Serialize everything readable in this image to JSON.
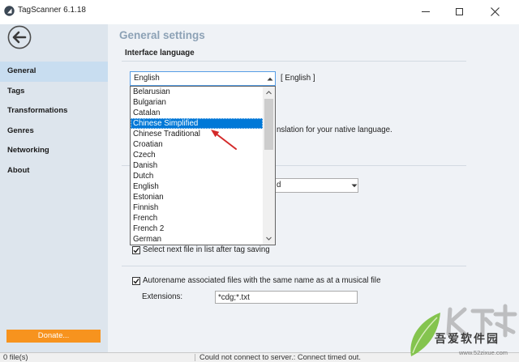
{
  "window": {
    "title": "TagScanner 6.1.18"
  },
  "icons": {
    "app": "app-icon",
    "back": "back-arrow-icon",
    "minimize": "minimize-icon",
    "maximize": "maximize-icon",
    "close": "close-icon",
    "dropdown": "dropdown-arrow-icon",
    "scroll_up": "scroll-up-icon",
    "scroll_down": "scroll-down-icon",
    "check": "checkmark-icon"
  },
  "colors": {
    "accent": "#0078d7",
    "sidebar_bg": "#dde5ed",
    "content_bg": "#eff2f6",
    "nav_selected_bg": "#c8ddf0",
    "donate_bg": "#f7931e",
    "heading": "#8da2b6",
    "annotation_arrow": "#d42a2a"
  },
  "sidebar": {
    "items": [
      {
        "label": "General",
        "selected": true
      },
      {
        "label": "Tags",
        "selected": false
      },
      {
        "label": "Transformations",
        "selected": false
      },
      {
        "label": "Genres",
        "selected": false
      },
      {
        "label": "Networking",
        "selected": false
      },
      {
        "label": "About",
        "selected": false
      }
    ],
    "donate_label": "Donate..."
  },
  "main": {
    "heading": "General settings",
    "language": {
      "section_label": "Interface language",
      "selected_value": "English",
      "current_language": "[ English ]",
      "dropdown_open": true,
      "options": [
        "Belarusian",
        "Bulgarian",
        "Catalan",
        "Chinese Simplified",
        "Chinese Traditional",
        "Croatian",
        "Czech",
        "Danish",
        "Dutch",
        "English",
        "Estonian",
        "Finnish",
        "French",
        "French 2",
        "German"
      ],
      "highlighted_index": 3,
      "hint_text_visible": "nslation for your native language."
    },
    "second_combo": {
      "visible_text": "d"
    },
    "select_next_file": {
      "label": "Select next file in list after tag saving",
      "checked": true
    },
    "autorename": {
      "label": "Autorename associated files with the same name as at a musical file",
      "checked": true
    },
    "extensions": {
      "label": "Extensions:",
      "value": "*cdg;*.txt"
    }
  },
  "status_bar": {
    "files": "0 file(s)",
    "message": "Could not connect to server.: Connect timed out."
  },
  "watermark": {
    "site_name": "吾爱软件园",
    "url": "www.52zixue.com"
  }
}
